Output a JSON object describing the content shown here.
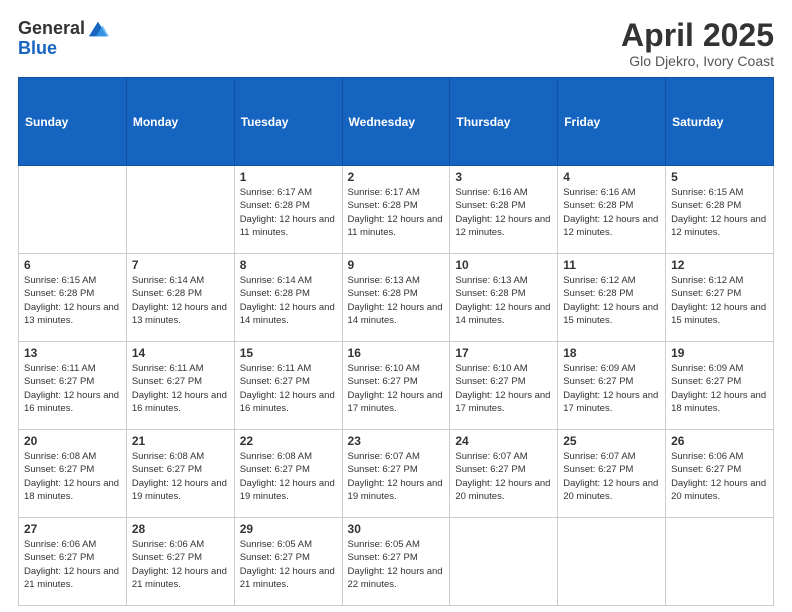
{
  "logo": {
    "general": "General",
    "blue": "Blue"
  },
  "title": {
    "month": "April 2025",
    "location": "Glo Djekro, Ivory Coast"
  },
  "headers": [
    "Sunday",
    "Monday",
    "Tuesday",
    "Wednesday",
    "Thursday",
    "Friday",
    "Saturday"
  ],
  "weeks": [
    [
      {
        "day": "",
        "info": ""
      },
      {
        "day": "",
        "info": ""
      },
      {
        "day": "1",
        "info": "Sunrise: 6:17 AM\nSunset: 6:28 PM\nDaylight: 12 hours and 11 minutes."
      },
      {
        "day": "2",
        "info": "Sunrise: 6:17 AM\nSunset: 6:28 PM\nDaylight: 12 hours and 11 minutes."
      },
      {
        "day": "3",
        "info": "Sunrise: 6:16 AM\nSunset: 6:28 PM\nDaylight: 12 hours and 12 minutes."
      },
      {
        "day": "4",
        "info": "Sunrise: 6:16 AM\nSunset: 6:28 PM\nDaylight: 12 hours and 12 minutes."
      },
      {
        "day": "5",
        "info": "Sunrise: 6:15 AM\nSunset: 6:28 PM\nDaylight: 12 hours and 12 minutes."
      }
    ],
    [
      {
        "day": "6",
        "info": "Sunrise: 6:15 AM\nSunset: 6:28 PM\nDaylight: 12 hours and 13 minutes."
      },
      {
        "day": "7",
        "info": "Sunrise: 6:14 AM\nSunset: 6:28 PM\nDaylight: 12 hours and 13 minutes."
      },
      {
        "day": "8",
        "info": "Sunrise: 6:14 AM\nSunset: 6:28 PM\nDaylight: 12 hours and 14 minutes."
      },
      {
        "day": "9",
        "info": "Sunrise: 6:13 AM\nSunset: 6:28 PM\nDaylight: 12 hours and 14 minutes."
      },
      {
        "day": "10",
        "info": "Sunrise: 6:13 AM\nSunset: 6:28 PM\nDaylight: 12 hours and 14 minutes."
      },
      {
        "day": "11",
        "info": "Sunrise: 6:12 AM\nSunset: 6:28 PM\nDaylight: 12 hours and 15 minutes."
      },
      {
        "day": "12",
        "info": "Sunrise: 6:12 AM\nSunset: 6:27 PM\nDaylight: 12 hours and 15 minutes."
      }
    ],
    [
      {
        "day": "13",
        "info": "Sunrise: 6:11 AM\nSunset: 6:27 PM\nDaylight: 12 hours and 16 minutes."
      },
      {
        "day": "14",
        "info": "Sunrise: 6:11 AM\nSunset: 6:27 PM\nDaylight: 12 hours and 16 minutes."
      },
      {
        "day": "15",
        "info": "Sunrise: 6:11 AM\nSunset: 6:27 PM\nDaylight: 12 hours and 16 minutes."
      },
      {
        "day": "16",
        "info": "Sunrise: 6:10 AM\nSunset: 6:27 PM\nDaylight: 12 hours and 17 minutes."
      },
      {
        "day": "17",
        "info": "Sunrise: 6:10 AM\nSunset: 6:27 PM\nDaylight: 12 hours and 17 minutes."
      },
      {
        "day": "18",
        "info": "Sunrise: 6:09 AM\nSunset: 6:27 PM\nDaylight: 12 hours and 17 minutes."
      },
      {
        "day": "19",
        "info": "Sunrise: 6:09 AM\nSunset: 6:27 PM\nDaylight: 12 hours and 18 minutes."
      }
    ],
    [
      {
        "day": "20",
        "info": "Sunrise: 6:08 AM\nSunset: 6:27 PM\nDaylight: 12 hours and 18 minutes."
      },
      {
        "day": "21",
        "info": "Sunrise: 6:08 AM\nSunset: 6:27 PM\nDaylight: 12 hours and 19 minutes."
      },
      {
        "day": "22",
        "info": "Sunrise: 6:08 AM\nSunset: 6:27 PM\nDaylight: 12 hours and 19 minutes."
      },
      {
        "day": "23",
        "info": "Sunrise: 6:07 AM\nSunset: 6:27 PM\nDaylight: 12 hours and 19 minutes."
      },
      {
        "day": "24",
        "info": "Sunrise: 6:07 AM\nSunset: 6:27 PM\nDaylight: 12 hours and 20 minutes."
      },
      {
        "day": "25",
        "info": "Sunrise: 6:07 AM\nSunset: 6:27 PM\nDaylight: 12 hours and 20 minutes."
      },
      {
        "day": "26",
        "info": "Sunrise: 6:06 AM\nSunset: 6:27 PM\nDaylight: 12 hours and 20 minutes."
      }
    ],
    [
      {
        "day": "27",
        "info": "Sunrise: 6:06 AM\nSunset: 6:27 PM\nDaylight: 12 hours and 21 minutes."
      },
      {
        "day": "28",
        "info": "Sunrise: 6:06 AM\nSunset: 6:27 PM\nDaylight: 12 hours and 21 minutes."
      },
      {
        "day": "29",
        "info": "Sunrise: 6:05 AM\nSunset: 6:27 PM\nDaylight: 12 hours and 21 minutes."
      },
      {
        "day": "30",
        "info": "Sunrise: 6:05 AM\nSunset: 6:27 PM\nDaylight: 12 hours and 22 minutes."
      },
      {
        "day": "",
        "info": ""
      },
      {
        "day": "",
        "info": ""
      },
      {
        "day": "",
        "info": ""
      }
    ]
  ]
}
